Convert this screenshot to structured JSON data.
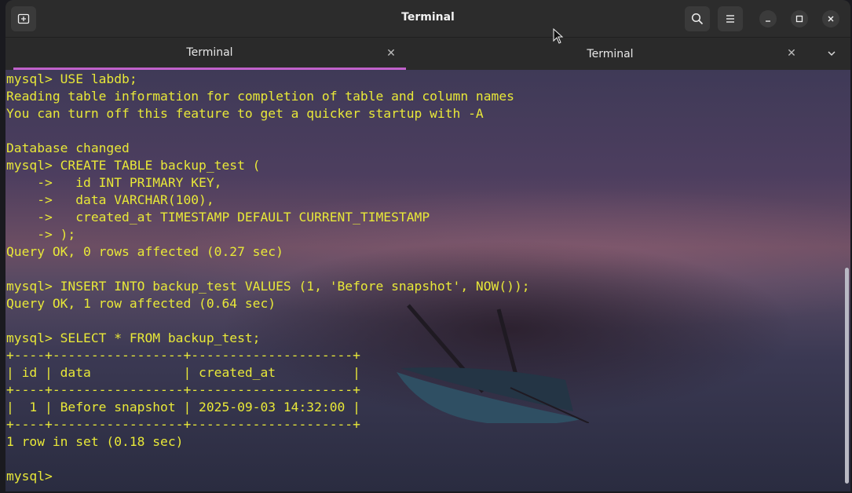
{
  "window": {
    "title": "Terminal"
  },
  "headerbar": {
    "new_tab_icon": "new-tab-icon",
    "search_icon": "search-icon",
    "menu_icon": "hamburger-menu-icon",
    "minimize_icon": "minimize-icon",
    "maximize_icon": "maximize-icon",
    "close_icon": "close-icon"
  },
  "tabs": [
    {
      "label": "Terminal",
      "active": true
    },
    {
      "label": "Terminal",
      "active": false
    }
  ],
  "colors": {
    "terminal_text": "#e8e838",
    "active_tab_indicator": "#c061cb",
    "headerbar_bg": "#2c2c2c"
  },
  "terminal": {
    "lines": [
      "mysql> USE labdb;",
      "Reading table information for completion of table and column names",
      "You can turn off this feature to get a quicker startup with -A",
      "",
      "Database changed",
      "mysql> CREATE TABLE backup_test (",
      "    ->   id INT PRIMARY KEY,",
      "    ->   data VARCHAR(100),",
      "    ->   created_at TIMESTAMP DEFAULT CURRENT_TIMESTAMP",
      "    -> );",
      "Query OK, 0 rows affected (0.27 sec)",
      "",
      "mysql> INSERT INTO backup_test VALUES (1, 'Before snapshot', NOW());",
      "Query OK, 1 row affected (0.64 sec)",
      "",
      "mysql> SELECT * FROM backup_test;",
      "+----+-----------------+---------------------+",
      "| id | data            | created_at          |",
      "+----+-----------------+---------------------+",
      "|  1 | Before snapshot | 2025-09-03 14:32:00 |",
      "+----+-----------------+---------------------+",
      "1 row in set (0.18 sec)",
      "",
      "mysql> "
    ]
  }
}
